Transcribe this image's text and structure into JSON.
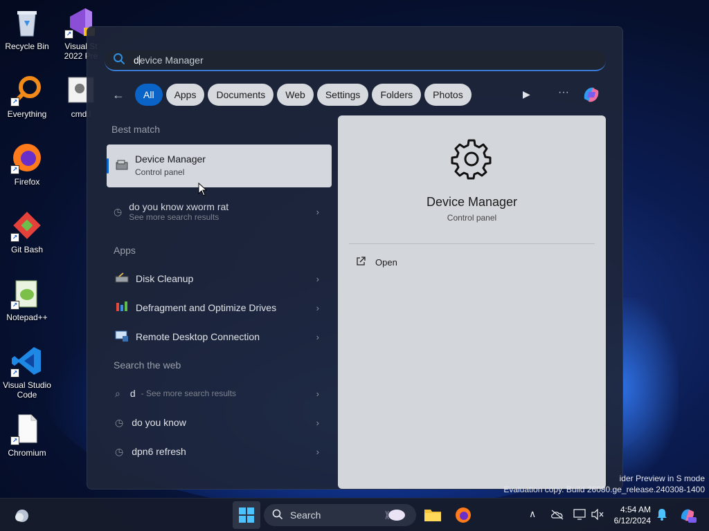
{
  "desktop": {
    "icons": [
      {
        "label": "Recycle Bin"
      },
      {
        "label_line1": "Visual St",
        "label_line2": "2022 Pre"
      },
      {
        "label": "Everything"
      },
      {
        "label": "cmd.l"
      },
      {
        "label": "Firefox"
      },
      {
        "label": "Git Bash"
      },
      {
        "label": "Notepad++"
      },
      {
        "label_line1": "Visual Studio",
        "label_line2": "Code"
      },
      {
        "label": "Chromium"
      }
    ],
    "watermark_line1": "ider Preview in S mode",
    "watermark_line2": "Evaluation copy. Build 26080.ge_release.240308-1400"
  },
  "search_panel": {
    "query_typed": "d",
    "query_suggestion": "evice Manager",
    "filters": [
      "All",
      "Apps",
      "Documents",
      "Web",
      "Settings",
      "Folders",
      "Photos"
    ],
    "active_filter": "All",
    "more_label": "···",
    "best_match_heading": "Best match",
    "best_match": {
      "title": "Device Manager",
      "subtitle": "Control panel"
    },
    "web_suggestion": {
      "title": "do you know xworm rat",
      "subtitle": "See more search results"
    },
    "apps_heading": "Apps",
    "apps": [
      "Disk Cleanup",
      "Defragment and Optimize Drives",
      "Remote Desktop Connection"
    ],
    "web_heading": "Search the web",
    "web_results": [
      {
        "query": "d",
        "hint": "- See more search results"
      },
      {
        "query": "do you know",
        "hint": ""
      },
      {
        "query": "dpn6 refresh",
        "hint": ""
      }
    ],
    "details": {
      "name": "Device Manager",
      "category": "Control panel",
      "open_label": "Open"
    }
  },
  "taskbar": {
    "search_label": "Search",
    "time": "4:54 AM",
    "date": "6/12/2024"
  },
  "colors": {
    "accent": "#0a64c8",
    "panel_bg": "#1e263a",
    "chip_bg": "#d6d9de"
  }
}
